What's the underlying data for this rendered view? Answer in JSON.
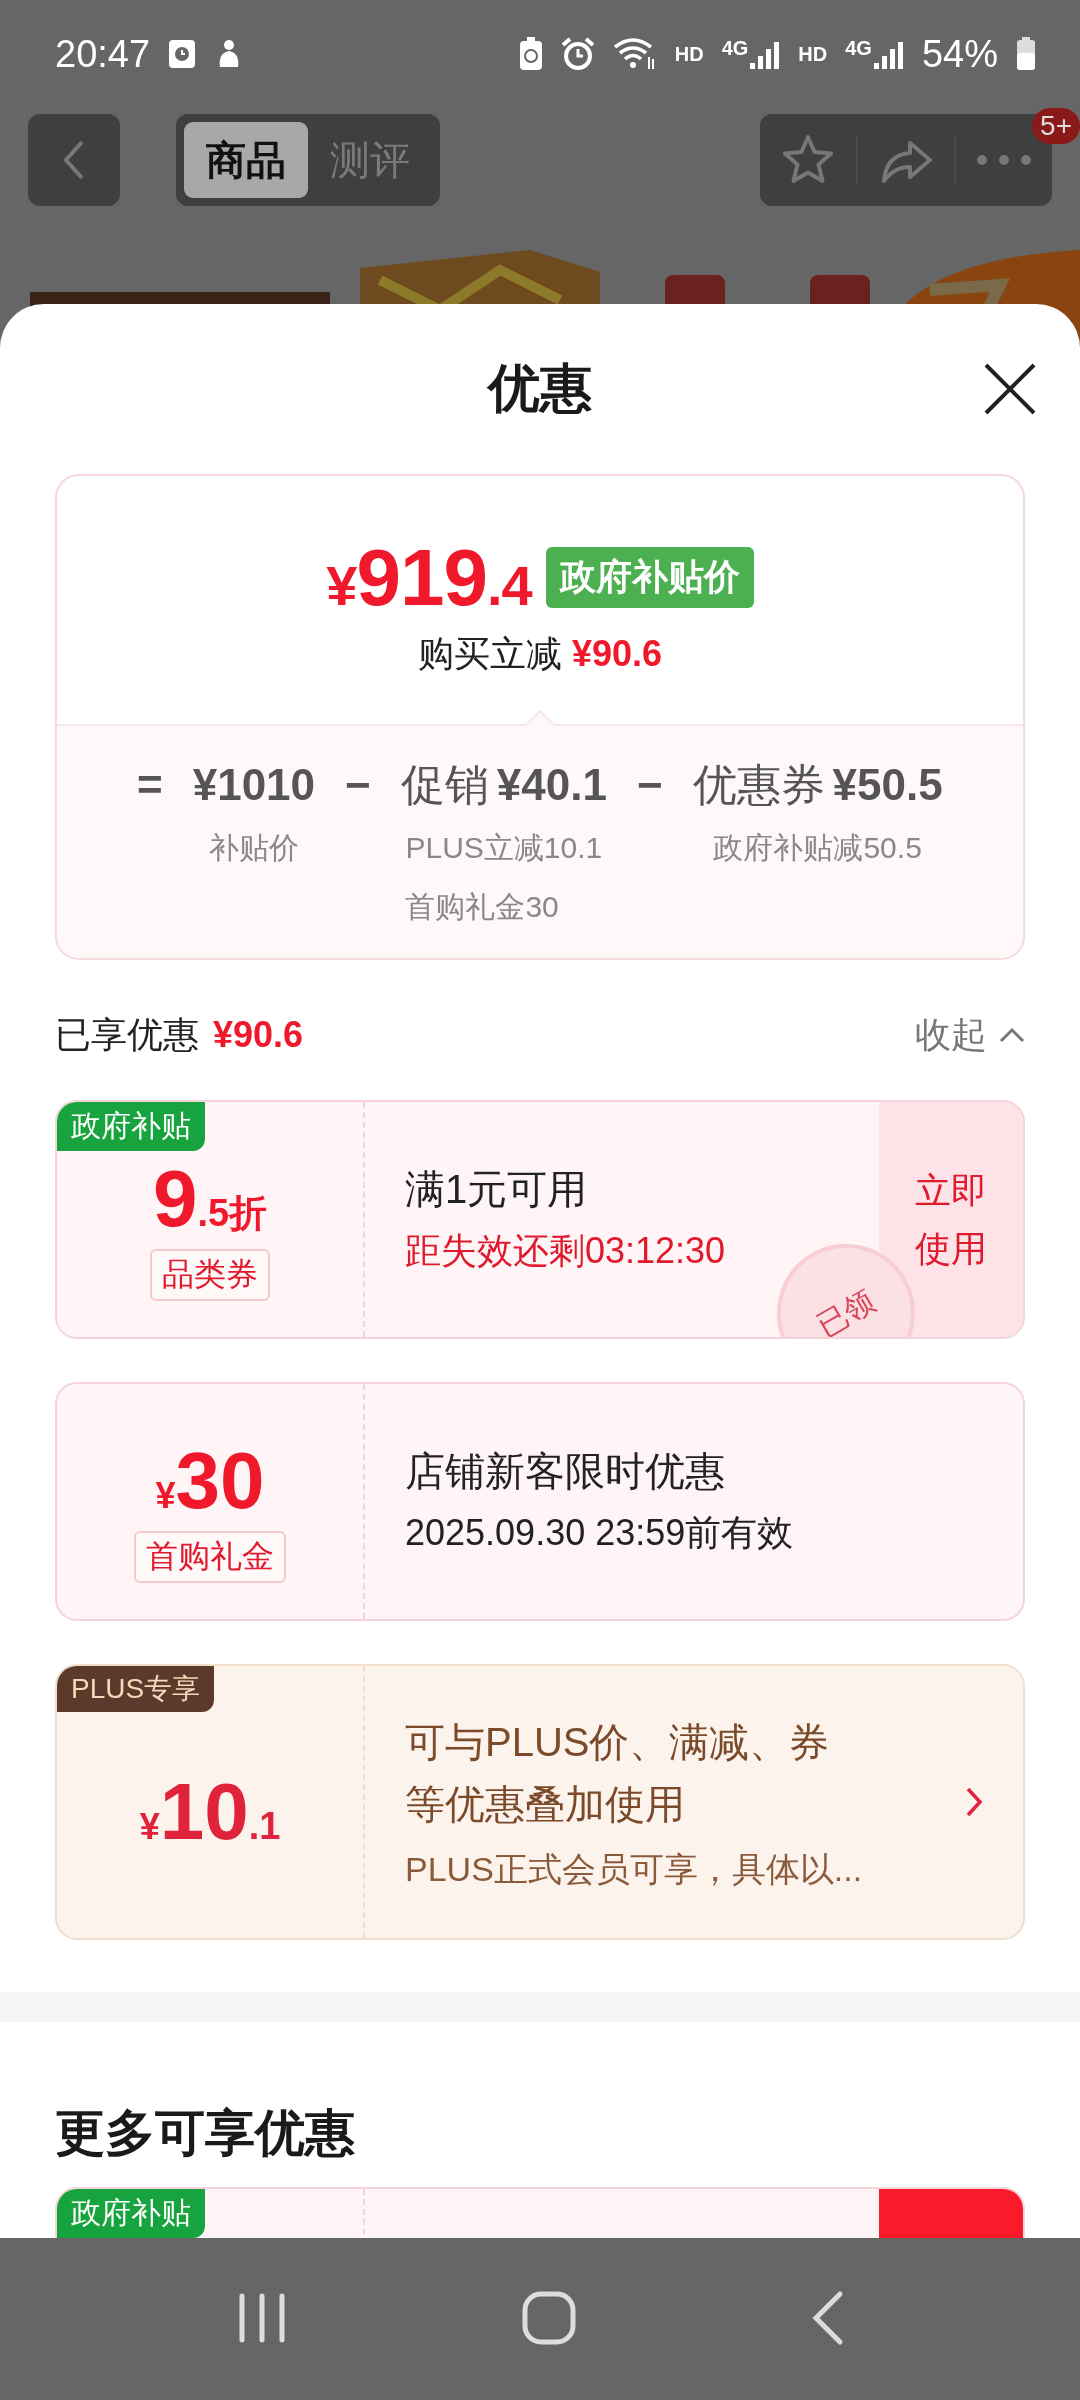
{
  "status_bar": {
    "time": "20:47",
    "hd_1": "HD",
    "network_1": "4G",
    "hd_2": "HD",
    "network_2": "4G",
    "battery": "54%"
  },
  "top_nav": {
    "tabs": [
      {
        "label": "商品",
        "selected": true
      },
      {
        "label": "测评",
        "selected": false
      }
    ],
    "badge": "5+"
  },
  "sheet": {
    "title": "优惠"
  },
  "summary": {
    "currency": "¥",
    "price_int": "919",
    "price_dec": ".4",
    "price_tag": "政府补贴价",
    "saving_label": "购买立减",
    "saving_value": "¥90.6",
    "breakdown": [
      {
        "operator": "=",
        "value": "¥1010",
        "notes": [
          "补贴价"
        ]
      },
      {
        "operator": "−",
        "label": "促销",
        "value": "¥40.1",
        "notes": [
          "PLUS立减10.1",
          "首购礼金30"
        ]
      },
      {
        "operator": "−",
        "label": "优惠券",
        "value": "¥50.5",
        "notes": [
          "政府补贴减50.5"
        ]
      }
    ]
  },
  "enjoyed": {
    "label": "已享优惠",
    "value": "¥90.6",
    "toggle": "收起",
    "expanded": true
  },
  "coupons": [
    {
      "kind": "discount",
      "tag": "政府补贴",
      "amount_main": "9",
      "amount_minor": ".5折",
      "type_label": "品类券",
      "title": "满1元可用",
      "subtitle": "距失效还剩03:12:30",
      "action": "立即使用",
      "stamp": "已领"
    },
    {
      "kind": "cash",
      "currency": "¥",
      "amount_main": "30",
      "type_label": "首购礼金",
      "title": "店铺新客限时优惠",
      "subtitle": "2025.09.30 23:59前有效"
    },
    {
      "kind": "plus",
      "tag": "PLUS专享",
      "currency": "¥",
      "amount_main": "10",
      "amount_minor": ".1",
      "title_lines": [
        "可与PLUS价、满减、券",
        "等优惠叠加使用"
      ],
      "subtitle": "PLUS正式会员可享，具体以..."
    }
  ],
  "more_offers": {
    "title": "更多可享优惠",
    "coupons": [
      {
        "kind": "discount",
        "tag": "政府补贴"
      }
    ]
  }
}
